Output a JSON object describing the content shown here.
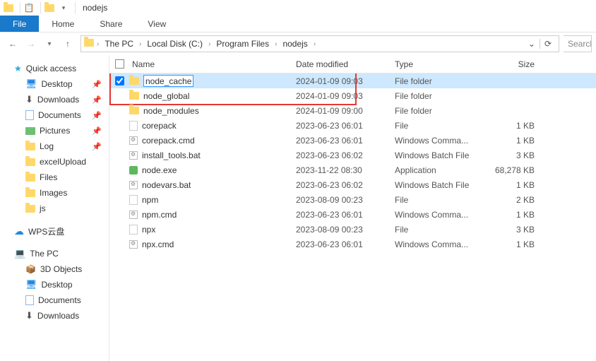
{
  "titlebar": {
    "title": "nodejs"
  },
  "tabs": {
    "file": "File",
    "home": "Home",
    "share": "Share",
    "view": "View"
  },
  "breadcrumb": [
    "The PC",
    "Local Disk (C:)",
    "Program Files",
    "nodejs"
  ],
  "search_placeholder": "Search",
  "columns": {
    "name": "Name",
    "date": "Date modified",
    "type": "Type",
    "size": "Size"
  },
  "sidebar": {
    "quick": "Quick access",
    "desktop": "Desktop",
    "downloads": "Downloads",
    "documents": "Documents",
    "pictures": "Pictures",
    "log": "Log",
    "excel": "excelUpload",
    "files": "Files",
    "images": "Images",
    "js": "js",
    "wps": "WPS云盘",
    "thepc": "The PC",
    "objects3d": "3D Objects",
    "desktop2": "Desktop",
    "documents2": "Documents",
    "downloads2": "Downloads"
  },
  "rows": [
    {
      "icon": "folder",
      "name": "node_cache",
      "date": "2024-01-09 09:03",
      "type": "File folder",
      "size": "",
      "selected": true,
      "editing": true
    },
    {
      "icon": "folder",
      "name": "node_global",
      "date": "2024-01-09 09:03",
      "type": "File folder",
      "size": ""
    },
    {
      "icon": "folder",
      "name": "node_modules",
      "date": "2024-01-09 09:00",
      "type": "File folder",
      "size": ""
    },
    {
      "icon": "file",
      "name": "corepack",
      "date": "2023-06-23 06:01",
      "type": "File",
      "size": "1 KB"
    },
    {
      "icon": "bat",
      "name": "corepack.cmd",
      "date": "2023-06-23 06:01",
      "type": "Windows Comma...",
      "size": "1 KB"
    },
    {
      "icon": "bat",
      "name": "install_tools.bat",
      "date": "2023-06-23 06:02",
      "type": "Windows Batch File",
      "size": "3 KB"
    },
    {
      "icon": "app",
      "name": "node.exe",
      "date": "2023-11-22 08:30",
      "type": "Application",
      "size": "68,278 KB"
    },
    {
      "icon": "bat",
      "name": "nodevars.bat",
      "date": "2023-06-23 06:02",
      "type": "Windows Batch File",
      "size": "1 KB"
    },
    {
      "icon": "file",
      "name": "npm",
      "date": "2023-08-09 00:23",
      "type": "File",
      "size": "2 KB"
    },
    {
      "icon": "bat",
      "name": "npm.cmd",
      "date": "2023-06-23 06:01",
      "type": "Windows Comma...",
      "size": "1 KB"
    },
    {
      "icon": "file",
      "name": "npx",
      "date": "2023-08-09 00:23",
      "type": "File",
      "size": "3 KB"
    },
    {
      "icon": "bat",
      "name": "npx.cmd",
      "date": "2023-06-23 06:01",
      "type": "Windows Comma...",
      "size": "1 KB"
    }
  ]
}
